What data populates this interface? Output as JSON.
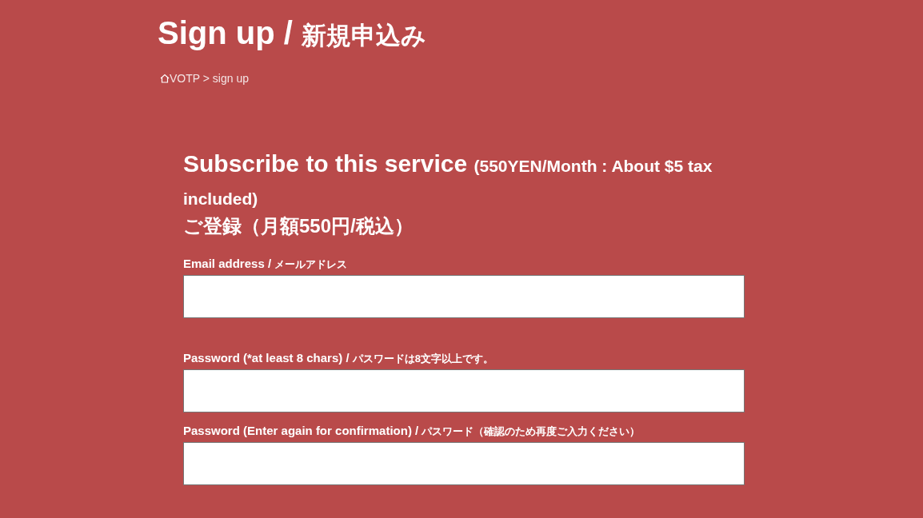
{
  "page_title": {
    "main": "Sign up /",
    "sub": "新規申込み"
  },
  "breadcrumb": {
    "text": "VOTP > sign up"
  },
  "heading": {
    "main": "Subscribe to this service",
    "sub": "(550YEN/Month : About $5 tax included)",
    "japanese": "ご登録（月額550円/税込）"
  },
  "fields": [
    {
      "label": "Email address /",
      "label_ja": "メールアドレス"
    },
    {
      "label": "Password (*at least 8 chars) /",
      "label_ja": "パスワードは8文字以上です。"
    },
    {
      "label": "Password (Enter again for confirmation) /",
      "label_ja": "パスワード（確認のため再度ご入力ください）"
    }
  ]
}
